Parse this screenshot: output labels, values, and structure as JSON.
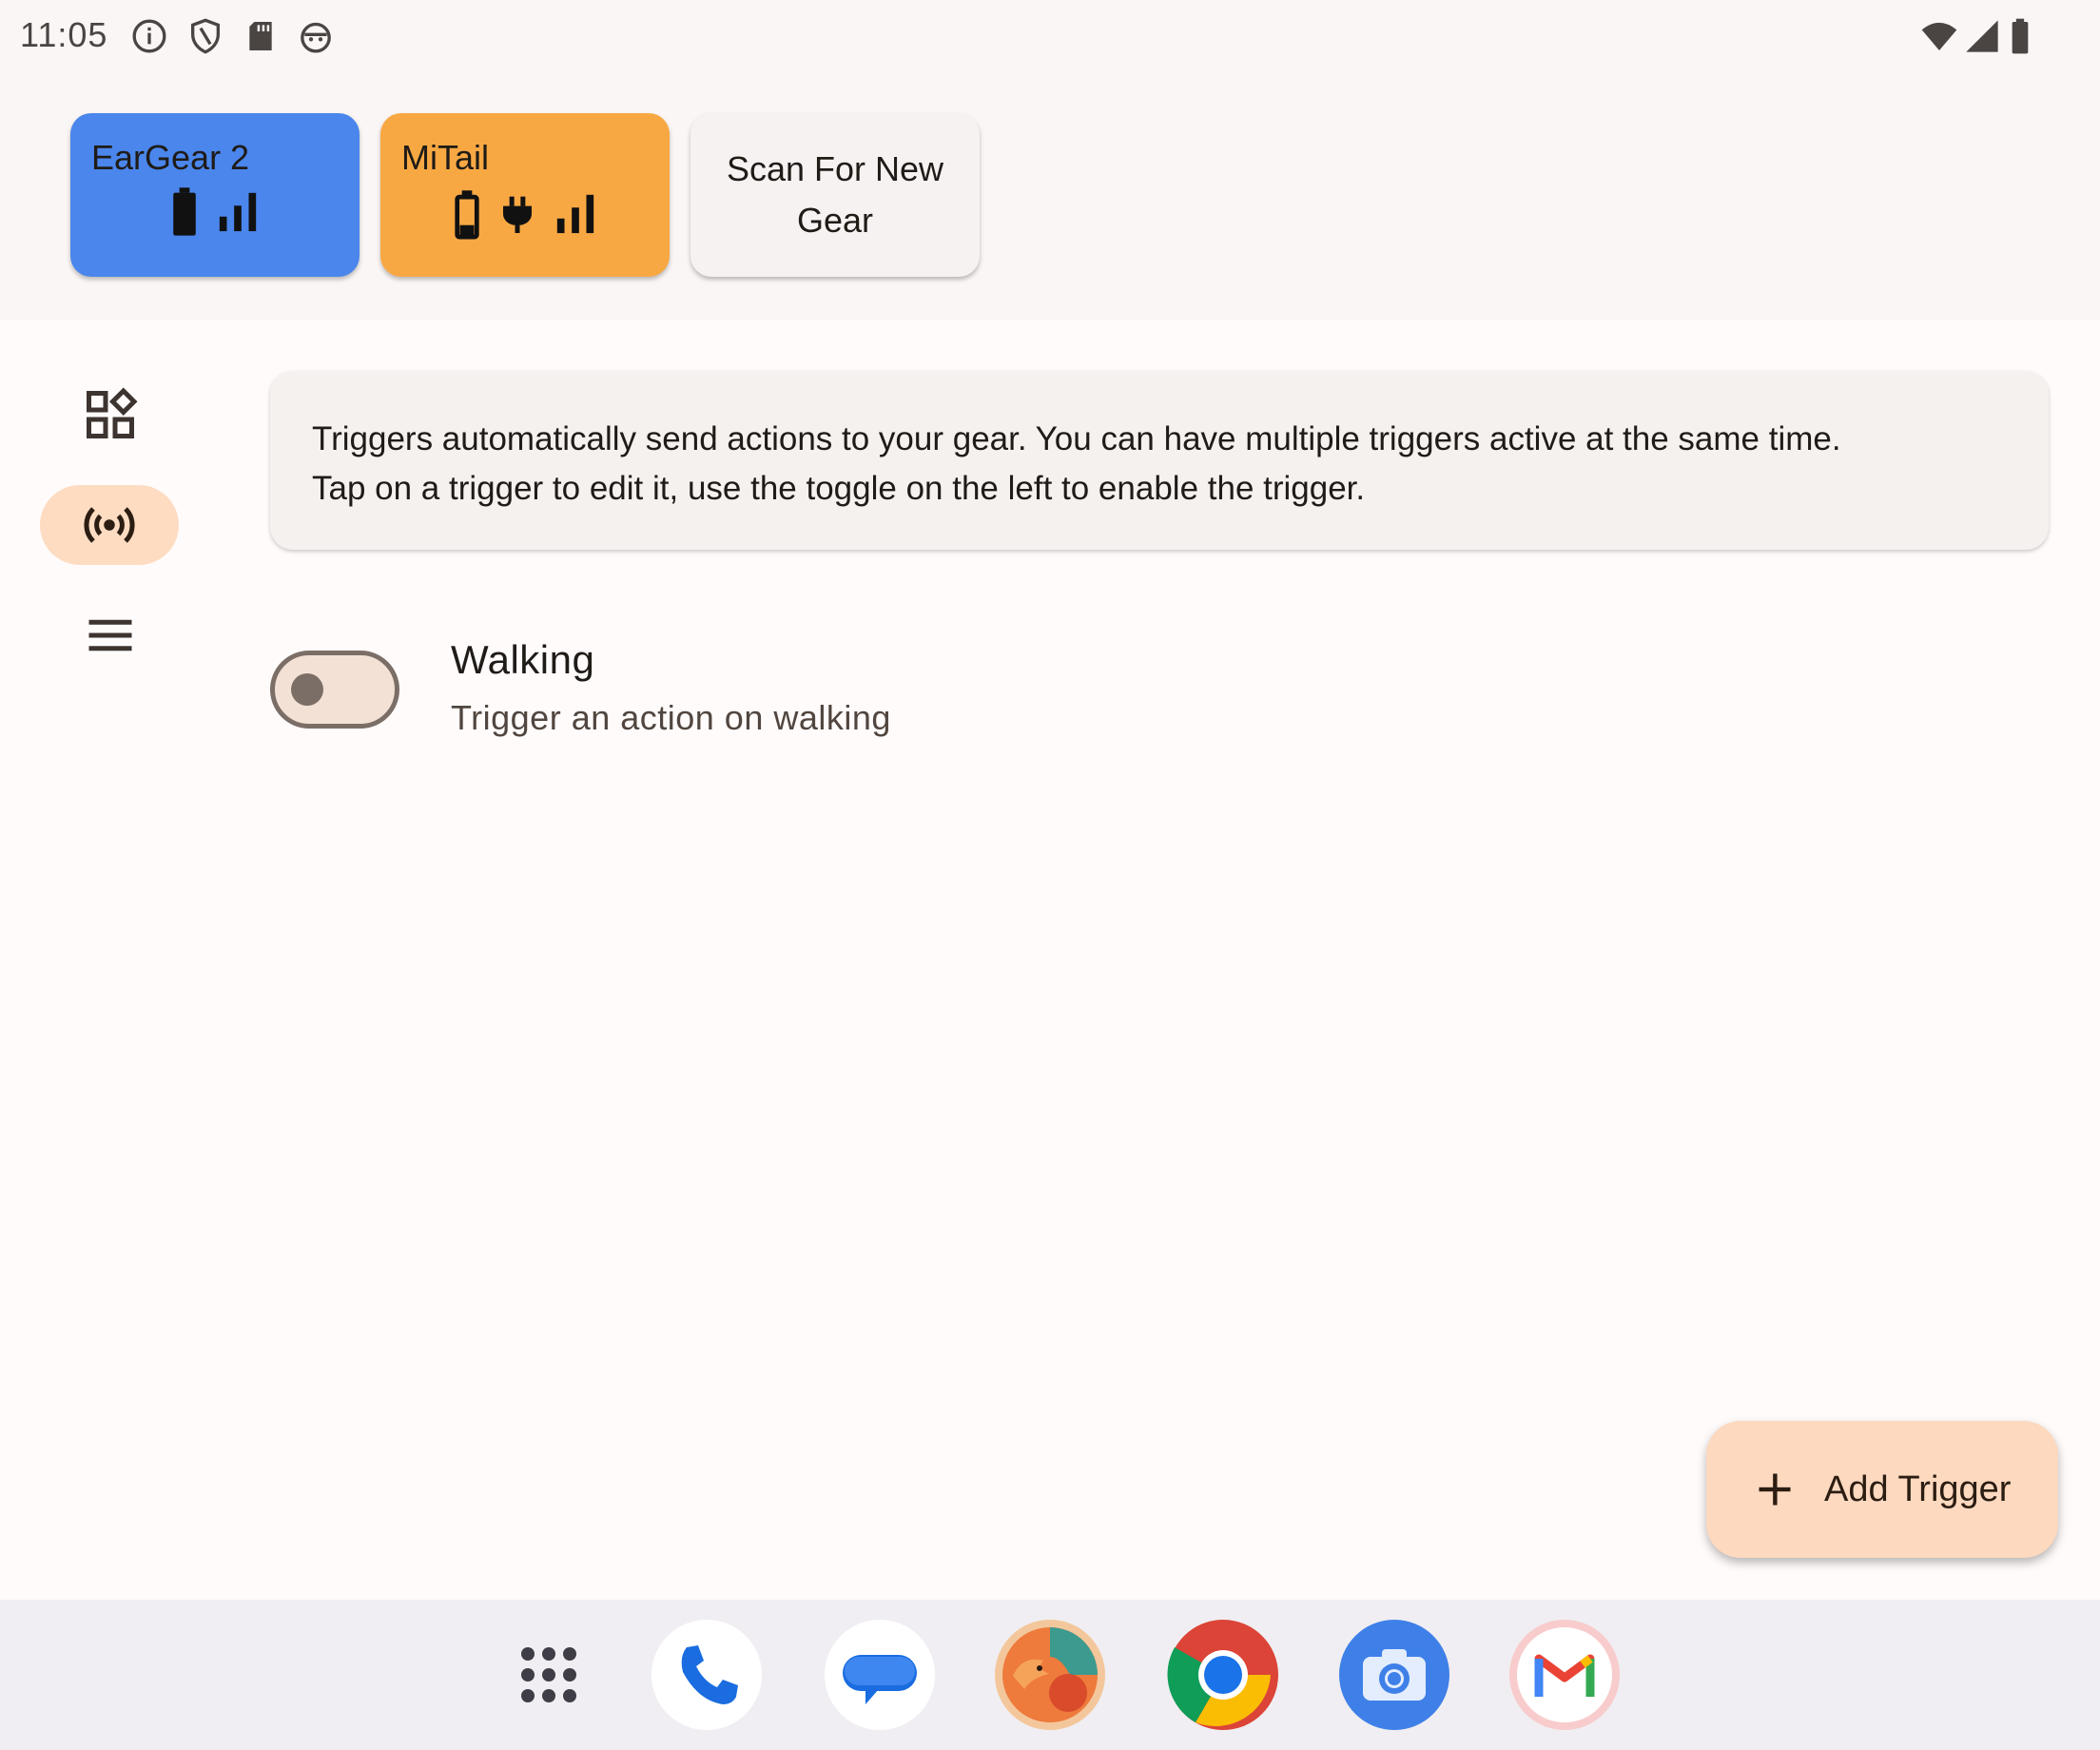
{
  "status_bar": {
    "time": "11:05",
    "left_icons": [
      "info-icon",
      "shield-icon",
      "sd-card-icon",
      "android-debug-icon"
    ],
    "right_icons": [
      "wifi-icon",
      "cell-signal-icon",
      "battery-icon"
    ]
  },
  "gear": [
    {
      "name": "EarGear 2",
      "color": "#4a86ec",
      "icons": [
        "battery-full-icon",
        "signal-bars-icon"
      ]
    },
    {
      "name": "MiTail",
      "color": "#f8a843",
      "icons": [
        "battery-low-icon",
        "charging-plug-icon",
        "signal-bars-icon"
      ]
    }
  ],
  "scan_button": {
    "line1": "Scan For New",
    "line2": "Gear"
  },
  "nav_rail": [
    "dashboard-icon",
    "triggers-icon",
    "menu-icon"
  ],
  "info": {
    "line1": "Triggers automatically send actions to your gear. You can have multiple triggers active at the same time.",
    "line2": "Tap on a trigger to edit it, use the toggle on the left to enable the trigger."
  },
  "triggers": [
    {
      "title": "Walking",
      "subtitle": "Trigger an action on walking",
      "enabled": false
    }
  ],
  "fab": {
    "label": "Add Trigger"
  },
  "dock": [
    "app-drawer-icon",
    "phone-icon",
    "messages-icon",
    "fox-app-icon",
    "chrome-icon",
    "camera-icon",
    "gmail-icon"
  ],
  "colors": {
    "accent_pill": "#fddcc2",
    "fab": "#fdd9bf",
    "toggle_outline": "#7b6e66"
  }
}
